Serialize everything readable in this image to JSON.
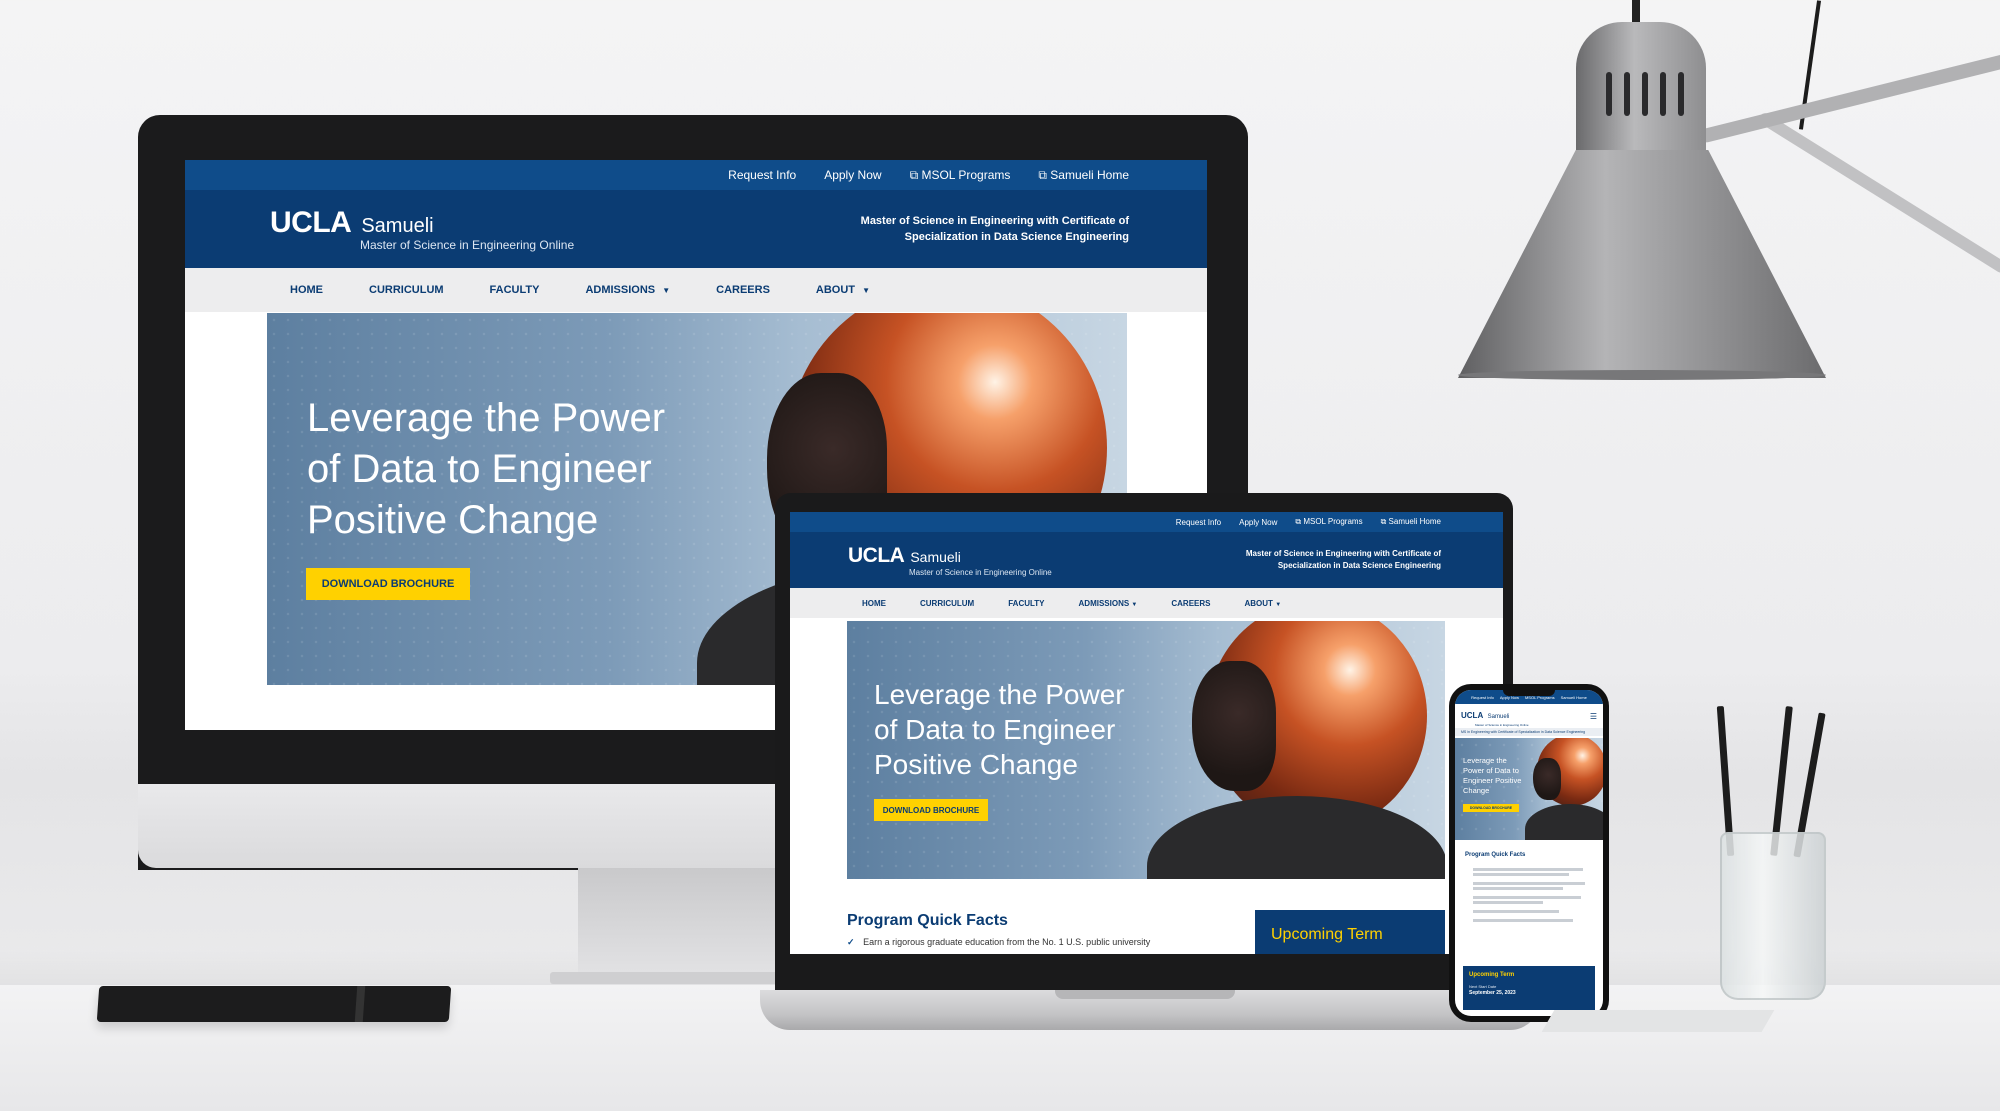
{
  "site": {
    "topbar": [
      "Request Info",
      "Apply Now",
      "MSOL Programs",
      "Samueli Home"
    ],
    "logo_ucla": "UCLA",
    "logo_samueli": "Samueli",
    "logo_sub": "Master of Science in Engineering Online",
    "tagline_1": "Master of Science in Engineering with Certificate of",
    "tagline_2": "Specialization in Data Science Engineering",
    "mobile_tagline": "MS in Engineering with Certificate of Specialization in Data Science Engineering",
    "nav": [
      "HOME",
      "CURRICULUM",
      "FACULTY",
      "ADMISSIONS",
      "CAREERS",
      "ABOUT"
    ],
    "hero_line_1": "Leverage the Power",
    "hero_line_2": "of Data to Engineer",
    "hero_line_3": "Positive Change",
    "mobile_hero_1": "Leverage the",
    "mobile_hero_2": "Power of Data to",
    "mobile_hero_3": "Engineer Positive",
    "mobile_hero_4": "Change",
    "cta": "DOWNLOAD BROCHURE",
    "facts_title": "Program Quick Facts",
    "fact_1": "Earn a rigorous graduate education from the No. 1 U.S. public university",
    "upcoming_term": "Upcoming Term",
    "next_start_label": "Next Start Date",
    "next_start_date": "September 25, 2023"
  },
  "colors": {
    "primary_blue": "#0b3c73",
    "top_blue": "#0f4c8a",
    "accent_yellow": "#ffd100",
    "nav_gray": "#ededee"
  },
  "icons": [
    "external-link-icon",
    "chevron-down-icon",
    "check-icon",
    "hamburger-menu-icon"
  ]
}
